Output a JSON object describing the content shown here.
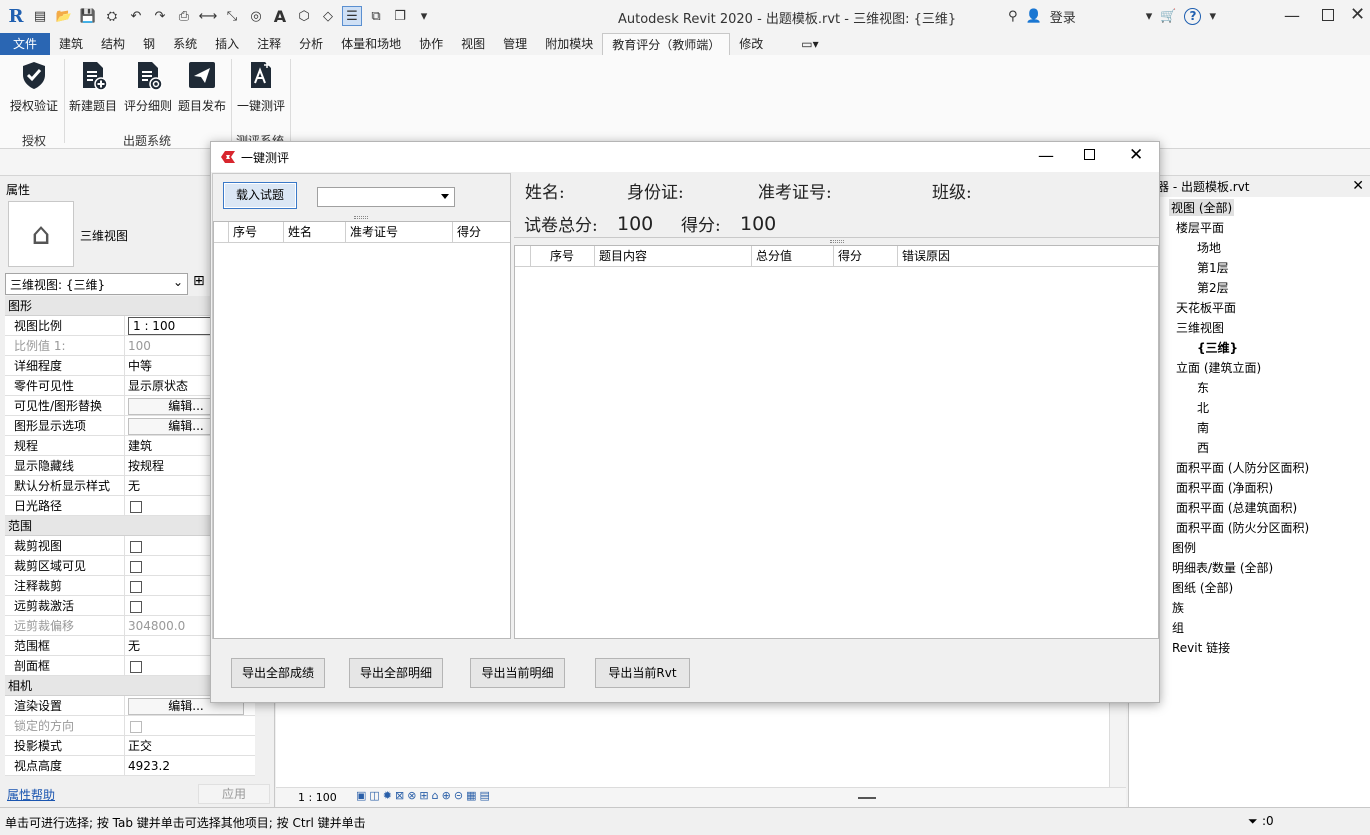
{
  "app": {
    "title": "Autodesk Revit 2020 - 出题模板.rvt - 三维视图: {三维}",
    "login": "登录"
  },
  "ribbon": {
    "tabs": [
      "文件",
      "建筑",
      "结构",
      "钢",
      "系统",
      "插入",
      "注释",
      "分析",
      "体量和场地",
      "协作",
      "视图",
      "管理",
      "附加模块",
      "教育评分（教师端）",
      "修改"
    ],
    "active_tab": "教育评分（教师端）",
    "buttons": {
      "auth": "授权验证",
      "new_question": "新建题目",
      "rubric": "评分细则",
      "publish": "题目发布",
      "one_click": "一键测评"
    },
    "groups": {
      "auth": "授权",
      "question_system": "出题系统",
      "eval_system": "测评系统"
    }
  },
  "properties": {
    "header": "属性",
    "name": "三维视图",
    "type_selector": "三维视图: {三维}",
    "groups": {
      "graphics": "图形",
      "extents": "范围",
      "camera": "相机"
    },
    "rows": {
      "view_scale": {
        "k": "视图比例",
        "v": "1 : 100"
      },
      "scale_value": {
        "k": "比例值 1:",
        "v": "100"
      },
      "detail_level": {
        "k": "详细程度",
        "v": "中等"
      },
      "parts_visibility": {
        "k": "零件可见性",
        "v": "显示原状态"
      },
      "vg_overrides": {
        "k": "可见性/图形替换",
        "v": "编辑..."
      },
      "graphic_display": {
        "k": "图形显示选项",
        "v": "编辑..."
      },
      "discipline": {
        "k": "规程",
        "v": "建筑"
      },
      "hidden_lines": {
        "k": "显示隐藏线",
        "v": "按规程"
      },
      "analysis_style": {
        "k": "默认分析显示样式",
        "v": "无"
      },
      "sun_path": {
        "k": "日光路径"
      },
      "crop_view": {
        "k": "裁剪视图"
      },
      "crop_visible": {
        "k": "裁剪区域可见"
      },
      "annotation_crop": {
        "k": "注释裁剪"
      },
      "far_clip_active": {
        "k": "远剪裁激活"
      },
      "far_clip_offset": {
        "k": "远剪裁偏移",
        "v": "304800.0"
      },
      "scope_box": {
        "k": "范围框",
        "v": "无"
      },
      "section_box": {
        "k": "剖面框"
      },
      "render_settings": {
        "k": "渲染设置",
        "v": "编辑..."
      },
      "locked_orientation": {
        "k": "锁定的方向"
      },
      "projection_mode": {
        "k": "投影模式",
        "v": "正交"
      },
      "eye_elevation": {
        "k": "视点高度",
        "v": "4923.2"
      }
    },
    "help": "属性帮助",
    "apply": "应用"
  },
  "view": {
    "scale": "1 : 100"
  },
  "browser": {
    "header": "浏览器 - 出题模板.rvt",
    "items": [
      "视图 (全部)",
      "楼层平面",
      "场地",
      "第1层",
      "第2层",
      "天花板平面",
      "三维视图",
      "{三维}",
      "立面 (建筑立面)",
      "东",
      "北",
      "南",
      "西",
      "面积平面 (人防分区面积)",
      "面积平面 (净面积)",
      "面积平面 (总建筑面积)",
      "面积平面 (防火分区面积)",
      "图例",
      "明细表/数量 (全部)",
      "图纸 (全部)",
      "族",
      "组",
      "Revit 链接"
    ]
  },
  "status": {
    "text": "单击可进行选择; 按 Tab 键并单击可选择其他项目; 按 Ctrl 键并单击",
    "filter": ":0"
  },
  "dialog": {
    "title": "一键测评",
    "load_button": "载入试题",
    "left_columns": [
      "序号",
      "姓名",
      "准考证号",
      "得分"
    ],
    "labels": {
      "name": "姓名:",
      "id_card": "身份证:",
      "exam_no": "准考证号:",
      "class": "班级:",
      "total": "试卷总分:",
      "score": "得分:"
    },
    "values": {
      "total": "100",
      "score": "100"
    },
    "right_columns": [
      "序号",
      "题目内容",
      "总分值",
      "得分",
      "错误原因"
    ],
    "buttons": {
      "export_all_scores": "导出全部成绩",
      "export_all_details": "导出全部明细",
      "export_current_details": "导出当前明细",
      "export_current_rvt": "导出当前Rvt"
    }
  }
}
